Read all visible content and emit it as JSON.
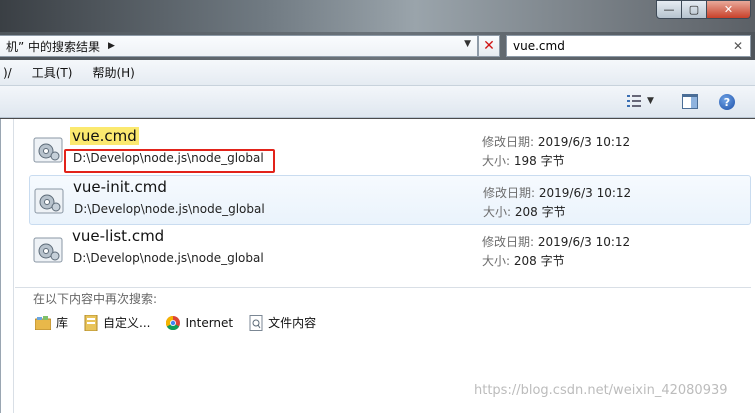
{
  "window": {
    "controls": {
      "minimize": "—",
      "maximize": "▢",
      "close": "✕"
    }
  },
  "address": {
    "breadcrumb": "机” 中的搜索结果",
    "breadcrumb_arrow": "▶",
    "dropdown_icon": "chevron-down-icon",
    "clear_symbol": "✕"
  },
  "search": {
    "value": "vue.cmd",
    "close_symbol": "✕"
  },
  "menu": {
    "partial": ")/",
    "tools": "工具(T)",
    "help": "帮助(H)"
  },
  "toolbar": {
    "views_icon": "view-list-icon",
    "preview_icon": "preview-pane-icon",
    "help_symbol": "?"
  },
  "labels": {
    "modified": "修改日期:",
    "size": "大小:"
  },
  "results": [
    {
      "name": "vue.cmd",
      "path": "D:\\Develop\\node.js\\node_global",
      "modified": "2019/6/3 10:12",
      "size": "198 字节",
      "highlighted": true
    },
    {
      "name": "vue-init.cmd",
      "path": "D:\\Develop\\node.js\\node_global",
      "modified": "2019/6/3 10:12",
      "size": "208 字节",
      "highlighted": false
    },
    {
      "name": "vue-list.cmd",
      "path": "D:\\Develop\\node.js\\node_global",
      "modified": "2019/6/3 10:12",
      "size": "208 字节",
      "highlighted": false
    }
  ],
  "search_again": {
    "title": "在以下内容中再次搜索:",
    "items": [
      "库",
      "自定义...",
      "Internet",
      "文件内容"
    ]
  },
  "watermark": "https://blog.csdn.net/weixin_42080939",
  "colors": {
    "highlight": "#fbe96f",
    "annotation_box": "#e2231a"
  }
}
